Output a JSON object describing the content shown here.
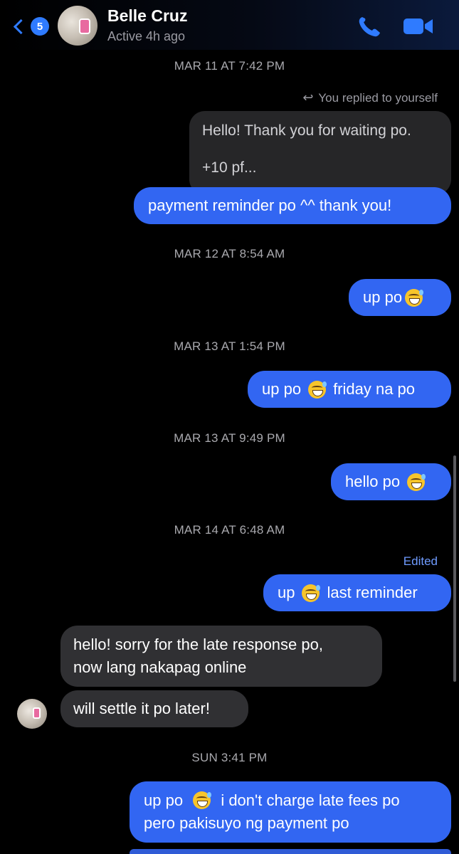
{
  "header": {
    "back_count": "5",
    "contact_name": "Belle Cruz",
    "status": "Active 4h ago",
    "icons": {
      "back": "chevron-left-icon",
      "call": "phone-icon",
      "video": "video-camera-icon"
    },
    "accent_color": "#2f7bff"
  },
  "timestamps": {
    "t1": "MAR 11 AT 7:42 PM",
    "t2": "MAR 12 AT 8:54 AM",
    "t3": "MAR 13 AT 1:54 PM",
    "t4": "MAR 13 AT 9:49 PM",
    "t5": "MAR 14 AT 6:48 AM",
    "t6": "SUN 3:41 PM"
  },
  "reply": {
    "label": "You replied to yourself",
    "quoted_line1": "Hello! Thank you for waiting po.",
    "quoted_line2": "+10 pf..."
  },
  "messages": {
    "m1": "payment reminder po ^^ thank you!",
    "m2": "up po",
    "m3_a": "up po",
    "m3_b": "friday na po",
    "m4": "hello po",
    "m5_a": "up",
    "m5_b": "last reminder",
    "m5_edited": "Edited",
    "in1_line1": "hello! sorry for the late response po,",
    "in1_line2": "now lang nakapag online",
    "in2": "will settle it po later!",
    "m6_line1_a": "up po",
    "m6_line1_b": "i don't charge late fees po",
    "m6_line2": "pero pakisuyo ng payment po"
  },
  "colors": {
    "outgoing_bubble": "#3266f2",
    "incoming_bubble": "#303033",
    "background": "#000000"
  },
  "emoji_name": "grinning-face-with-sweat"
}
